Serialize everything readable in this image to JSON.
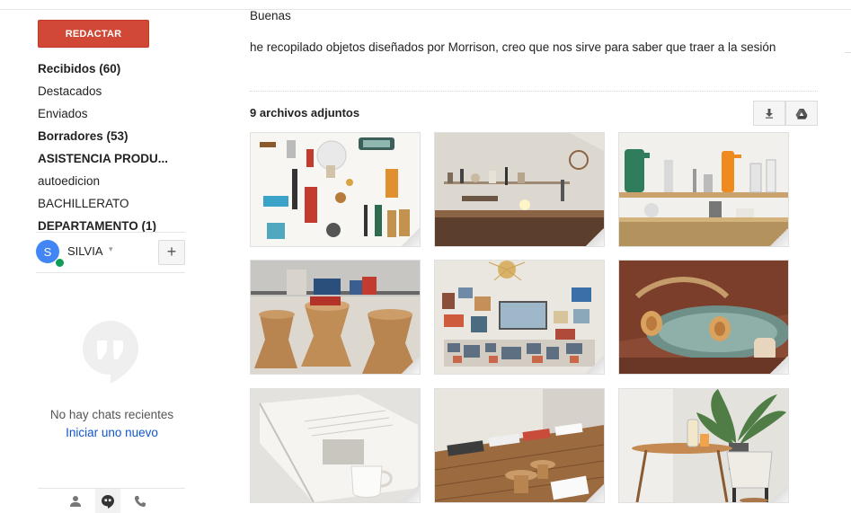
{
  "sidebar": {
    "compose_label": "REDACTAR",
    "items": [
      {
        "label": "Recibidos (60)",
        "bold": true
      },
      {
        "label": "Destacados",
        "bold": false
      },
      {
        "label": "Enviados",
        "bold": false
      },
      {
        "label": "Borradores (53)",
        "bold": true
      },
      {
        "label": "ASISTENCIA PRODU...",
        "bold": true
      },
      {
        "label": "autoedicion",
        "bold": false
      },
      {
        "label": "BACHILLERATO",
        "bold": false
      },
      {
        "label": "DEPARTAMENTO (1)",
        "bold": true
      }
    ],
    "account": {
      "initial": "S",
      "name": "SILVIA",
      "caret": "▾",
      "add": "+"
    },
    "chat": {
      "empty_text": "No hay chats recientes",
      "new_link": "Iniciar uno nuevo"
    },
    "tabs": [
      "person-icon",
      "hangouts-icon",
      "phone-icon"
    ]
  },
  "message": {
    "greeting": "Buenas",
    "body": "he recopilado objetos diseñados por Morrison, creo que nos sirve para saber que traer a la sesión"
  },
  "attachments": {
    "title": "9 archivos adjuntos",
    "download_icon": "download-icon",
    "drive_icon": "drive-icon",
    "items": [
      {
        "name": "attachment-1"
      },
      {
        "name": "attachment-2"
      },
      {
        "name": "attachment-3"
      },
      {
        "name": "attachment-4"
      },
      {
        "name": "attachment-5"
      },
      {
        "name": "attachment-6"
      },
      {
        "name": "attachment-7"
      },
      {
        "name": "attachment-8"
      },
      {
        "name": "attachment-9"
      }
    ]
  },
  "colors": {
    "compose": "#d14836",
    "link": "#1155cc",
    "avatar": "#4285f4",
    "online": "#0f9d58"
  }
}
